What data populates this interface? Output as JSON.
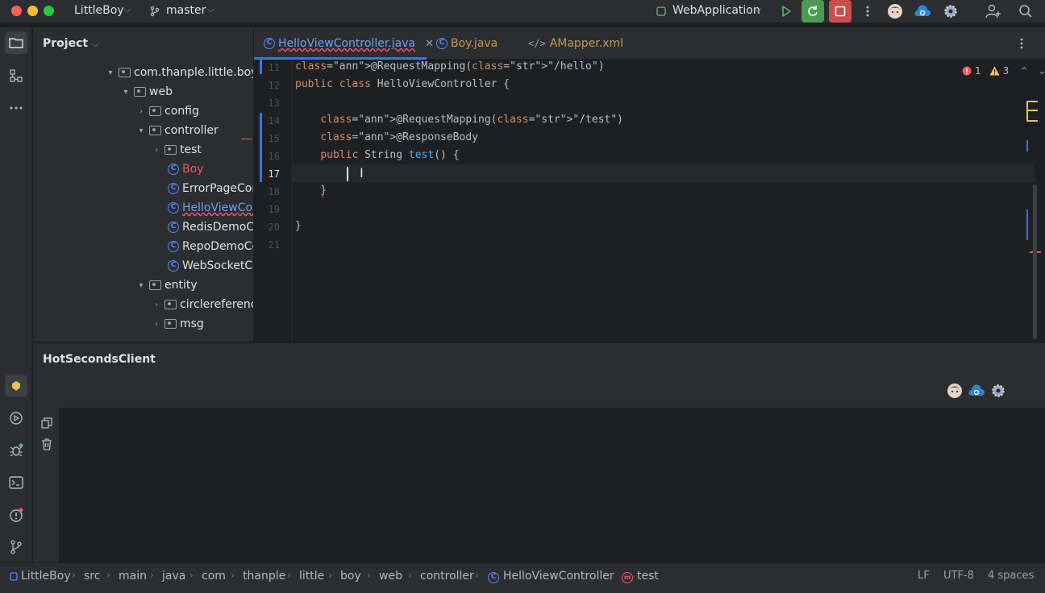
{
  "titlebar": {
    "project_name": "LittleBoy",
    "branch": "master",
    "run_config": "WebApplication"
  },
  "project_panel": {
    "title": "Project",
    "tree": [
      {
        "label": "com.thanple.little.boy",
        "type": "package",
        "expanded": true
      },
      {
        "label": "web",
        "type": "package",
        "expanded": true
      },
      {
        "label": "config",
        "type": "package",
        "expanded": false
      },
      {
        "label": "controller",
        "type": "package",
        "expanded": true
      },
      {
        "label": "test",
        "type": "package",
        "expanded": false
      },
      {
        "label": "Boy",
        "type": "class"
      },
      {
        "label": "ErrorPageCont",
        "type": "class"
      },
      {
        "label": "HelloViewCont",
        "type": "class"
      },
      {
        "label": "RedisDemoCo",
        "type": "class"
      },
      {
        "label": "RepoDemoCor",
        "type": "class"
      },
      {
        "label": "WebSocketCo",
        "type": "class"
      },
      {
        "label": "entity",
        "type": "package",
        "expanded": true
      },
      {
        "label": "circlereference",
        "type": "package",
        "expanded": false
      },
      {
        "label": "msg",
        "type": "package",
        "expanded": false
      }
    ]
  },
  "tabs": [
    {
      "label": "HelloViewController.java",
      "active": true
    },
    {
      "label": "Boy.java",
      "active": false
    },
    {
      "label": "AMapper.xml",
      "active": false
    }
  ],
  "inspections": {
    "errors": "1",
    "warnings": "3"
  },
  "code_lines": [
    {
      "num": "11",
      "text": "@RequestMapping(\"/hello\")"
    },
    {
      "num": "12",
      "text": "public class HelloViewController {"
    },
    {
      "num": "13",
      "text": ""
    },
    {
      "num": "14",
      "text": "    @RequestMapping(\"/test\")"
    },
    {
      "num": "15",
      "text": "    @ResponseBody"
    },
    {
      "num": "16",
      "text": "    public String test() {"
    },
    {
      "num": "17",
      "text": "        "
    },
    {
      "num": "18",
      "text": "    }"
    },
    {
      "num": "19",
      "text": ""
    },
    {
      "num": "20",
      "text": "}"
    },
    {
      "num": "21",
      "text": ""
    }
  ],
  "bottom_panel": {
    "title": "HotSecondsClient"
  },
  "breadcrumbs": [
    "LittleBoy",
    "src",
    "main",
    "java",
    "com",
    "thanple",
    "little",
    "boy",
    "web",
    "controller",
    "HelloViewController",
    "test"
  ],
  "status": {
    "line_sep": "LF",
    "encoding": "UTF-8",
    "indent": "4 spaces"
  },
  "colors": {
    "accent": "#3574f0",
    "error": "#f75464",
    "warning": "#f2c55c"
  }
}
